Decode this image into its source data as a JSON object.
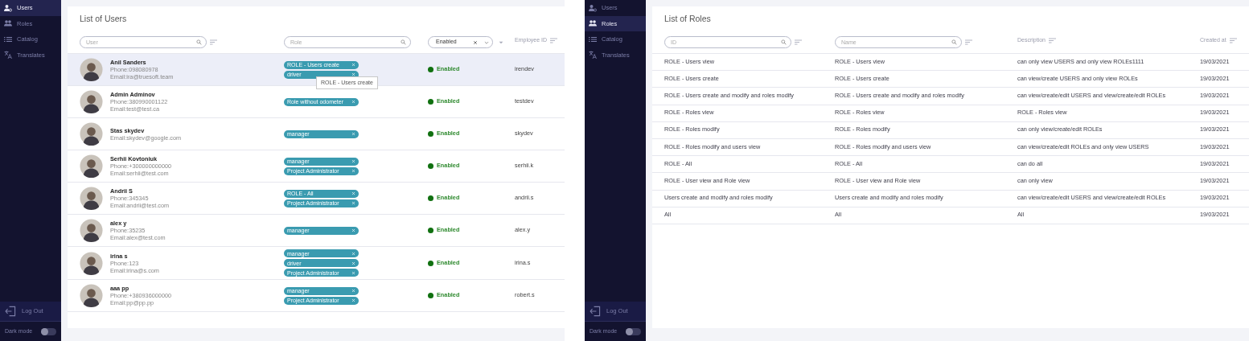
{
  "users_screen": {
    "sidebar": {
      "items": [
        {
          "kind": "users",
          "label": "Users",
          "selected": true
        },
        {
          "kind": "roles",
          "label": "Roles",
          "selected": false
        },
        {
          "kind": "catalog",
          "label": "Catalog",
          "selected": false
        },
        {
          "kind": "translates",
          "label": "Translates",
          "selected": false
        }
      ],
      "logout": "Log Out",
      "dark_mode": {
        "label": "Dark mode",
        "on": false
      }
    },
    "title": "List of Users",
    "columns": [
      {
        "kind": "filter",
        "placeholder": "User"
      },
      {
        "kind": "search",
        "placeholder": "Role"
      },
      {
        "kind": "select",
        "value": "Enabled"
      },
      {
        "kind": "header",
        "label": "Employee ID"
      }
    ],
    "rows": [
      {
        "highlighted": true,
        "name": "Anil Sanders",
        "phone": "Phone:098080978",
        "email": "Email:ira@truesoft.team",
        "roles": [
          {
            "label": "ROLE - Users create",
            "tooltip": "ROLE - Users create"
          },
          {
            "label": "driver"
          }
        ],
        "status": "Enabled",
        "employee_id": "irendev"
      },
      {
        "highlighted": false,
        "name": "Admin Adminov",
        "phone": "Phone:380990001122",
        "email": "Email:test@test.ca",
        "roles": [
          {
            "label": "Role without odometer"
          }
        ],
        "status": "Enabled",
        "employee_id": "testdev"
      },
      {
        "highlighted": false,
        "name": "Stas skydev",
        "email": "Email:skydev@google.com",
        "roles": [
          {
            "label": "manager"
          }
        ],
        "status": "Enabled",
        "employee_id": "skydev"
      },
      {
        "highlighted": false,
        "name": "Serhii Kovtoniuk",
        "phone": "Phone:+300000000000",
        "email": "Email:serhii@test.com",
        "roles": [
          {
            "label": "manager"
          },
          {
            "label": "Project Administrator"
          }
        ],
        "status": "Enabled",
        "employee_id": "serhii.k"
      },
      {
        "highlighted": false,
        "name": "Andrii S",
        "phone": "Phone:345345",
        "email": "Email:andrii@test.com",
        "roles": [
          {
            "label": "ROLE - All"
          },
          {
            "label": "Project Administrator"
          }
        ],
        "status": "Enabled",
        "employee_id": "andrii.s"
      },
      {
        "highlighted": false,
        "name": "alex y",
        "phone": "Phone:35235",
        "email": "Email:alex@test.com",
        "roles": [
          {
            "label": "manager"
          }
        ],
        "status": "Enabled",
        "employee_id": "alex.y"
      },
      {
        "highlighted": false,
        "name": "irina s",
        "phone": "Phone:123",
        "email": "Email:irina@s.com",
        "roles": [
          {
            "label": "manager"
          },
          {
            "label": "driver"
          },
          {
            "label": "Project Administrator"
          }
        ],
        "status": "Enabled",
        "employee_id": "irina.s"
      },
      {
        "highlighted": false,
        "name": "aaa pp",
        "phone": "Phone:+380936000000",
        "email": "Email:pp@pp.pp",
        "roles": [
          {
            "label": "manager"
          },
          {
            "label": "Project Administrator"
          }
        ],
        "status": "Enabled",
        "employee_id": "robert.s"
      }
    ]
  },
  "roles_screen": {
    "sidebar": {
      "items": [
        {
          "kind": "users",
          "label": "Users",
          "selected": false
        },
        {
          "kind": "roles",
          "label": "Roles",
          "selected": true
        },
        {
          "kind": "catalog",
          "label": "Catalog",
          "selected": false
        },
        {
          "kind": "translates",
          "label": "Translates",
          "selected": false
        }
      ],
      "logout": "Log Out",
      "dark_mode": {
        "label": "Dark mode",
        "on": false
      }
    },
    "title": "List of Roles",
    "columns": [
      {
        "kind": "filter",
        "placeholder": "ID"
      },
      {
        "kind": "filter",
        "placeholder": "Name"
      },
      {
        "kind": "header",
        "label": "Description"
      },
      {
        "kind": "header",
        "label": "Created at"
      }
    ],
    "rows": [
      {
        "id": "ROLE - Users view",
        "name": "ROLE - Users view",
        "description": "can only view USERS and only view ROLEs1111",
        "created_at": "19/03/2021"
      },
      {
        "id": "ROLE - Users create",
        "name": "ROLE - Users create",
        "description": "can view/create USERS and only view ROLEs",
        "created_at": "19/03/2021"
      },
      {
        "id": "ROLE - Users create and modify and roles modify",
        "name": "ROLE - Users create and modify and roles modify",
        "description": "can view/create/edit USERS and view/create/edit ROLEs",
        "created_at": "19/03/2021"
      },
      {
        "id": "ROLE - Roles view",
        "name": "ROLE - Roles view",
        "description": "ROLE - Roles view",
        "created_at": "19/03/2021"
      },
      {
        "id": "ROLE - Roles modify",
        "name": "ROLE - Roles modify",
        "description": "can only view/create/edit ROLEs",
        "created_at": "19/03/2021"
      },
      {
        "id": "ROLE - Roles modify and users view",
        "name": "ROLE - Roles modify and users view",
        "description": "can view/create/edit ROLEs and only view USERS",
        "created_at": "19/03/2021"
      },
      {
        "id": "ROLE - All",
        "name": "ROLE - All",
        "description": "can do all",
        "created_at": "19/03/2021"
      },
      {
        "id": "ROLE - User view and Role view",
        "name": "ROLE - User view and Role view",
        "description": "can only view",
        "created_at": "19/03/2021"
      },
      {
        "id": "Users create and modify and roles modify",
        "name": "Users create and modify and roles modify",
        "description": "can view/create/edit USERS and view/create/edit ROLEs",
        "created_at": "19/03/2021"
      },
      {
        "id": "All",
        "name": "All",
        "description": "All",
        "created_at": "19/03/2021"
      }
    ]
  }
}
